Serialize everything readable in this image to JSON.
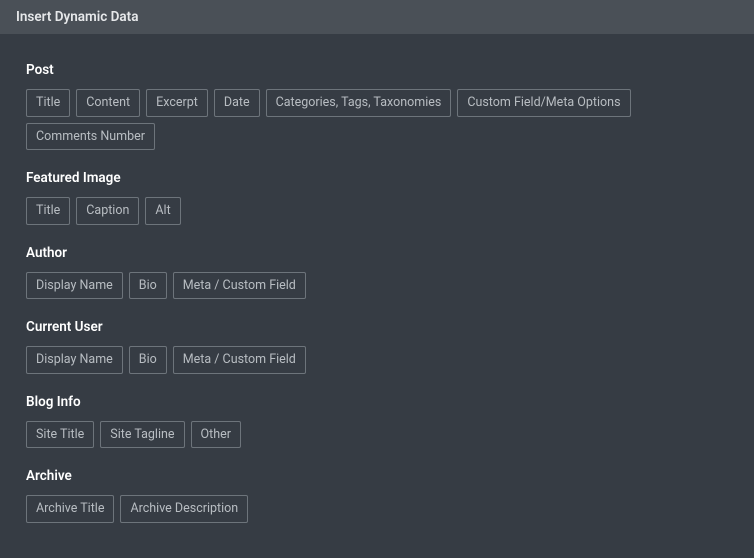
{
  "modal": {
    "title": "Insert Dynamic Data"
  },
  "sections": {
    "post": {
      "title": "Post",
      "items": [
        "Title",
        "Content",
        "Excerpt",
        "Date",
        "Categories, Tags, Taxonomies",
        "Custom Field/Meta Options",
        "Comments Number"
      ]
    },
    "featured_image": {
      "title": "Featured Image",
      "items": [
        "Title",
        "Caption",
        "Alt"
      ]
    },
    "author": {
      "title": "Author",
      "items": [
        "Display Name",
        "Bio",
        "Meta / Custom Field"
      ]
    },
    "current_user": {
      "title": "Current User",
      "items": [
        "Display Name",
        "Bio",
        "Meta / Custom Field"
      ]
    },
    "blog_info": {
      "title": "Blog Info",
      "items": [
        "Site Title",
        "Site Tagline",
        "Other"
      ]
    },
    "archive": {
      "title": "Archive",
      "items": [
        "Archive Title",
        "Archive Description"
      ]
    }
  }
}
